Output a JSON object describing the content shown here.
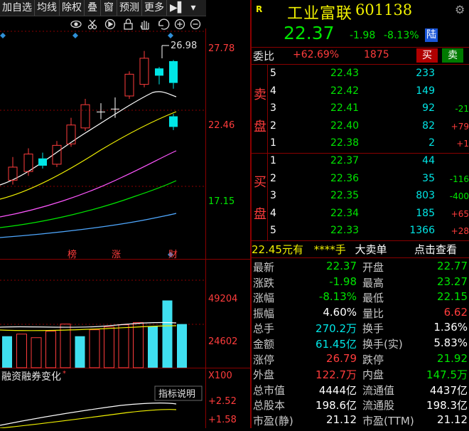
{
  "toolbar": {
    "items": [
      "加自选",
      "均线",
      "除权",
      "叠",
      "窗",
      "预测",
      "更多"
    ],
    "arrow_glyph": "▶▌",
    "dropdown_glyph": "▾"
  },
  "chart": {
    "price_ticks": [
      "27.78",
      "22.46",
      "17.15"
    ],
    "high_marker": "26.98",
    "event_markers": [
      "榜",
      "涨",
      "财"
    ],
    "volume_ticks": [
      "49204",
      "24602"
    ],
    "volume_unit": "X100",
    "indicator_title": "融资融券变化",
    "indicator_button": "指标说明",
    "indicator_ticks": [
      "+2.52",
      "+1.58"
    ],
    "candles": [
      {
        "o": 18.7,
        "c": 19.6,
        "h": 20.3,
        "l": 18.4
      },
      {
        "o": 19.3,
        "c": 20.5,
        "h": 20.9,
        "l": 19.0
      },
      {
        "o": 20.2,
        "c": 19.7,
        "h": 20.6,
        "l": 19.5
      },
      {
        "o": 19.8,
        "c": 21.1,
        "h": 21.4,
        "l": 19.6
      },
      {
        "o": 21.2,
        "c": 22.5,
        "h": 23.0,
        "l": 21.0
      },
      {
        "o": 22.3,
        "c": 23.9,
        "h": 24.3,
        "l": 22.1
      },
      {
        "o": 23.4,
        "c": 23.4,
        "h": 24.0,
        "l": 22.9
      },
      {
        "o": 23.6,
        "c": 23.6,
        "h": 24.4,
        "l": 23.0
      },
      {
        "o": 24.5,
        "c": 26.0,
        "h": 26.2,
        "l": 24.3
      },
      {
        "o": 25.3,
        "c": 27.1,
        "h": 27.6,
        "l": 25.1
      },
      {
        "o": 26.4,
        "c": 25.9,
        "h": 26.5,
        "l": 25.3
      },
      {
        "o": 26.9,
        "c": 25.4,
        "h": 26.98,
        "l": 25.0
      },
      {
        "o": 23.1,
        "c": 22.37,
        "h": 23.27,
        "l": 22.15
      }
    ],
    "volumes": [
      {
        "v": 22000,
        "up": false
      },
      {
        "v": 23500,
        "up": true
      },
      {
        "v": 21000,
        "up": true
      },
      {
        "v": 25500,
        "up": true
      },
      {
        "v": 30500,
        "up": true
      },
      {
        "v": 22000,
        "up": false
      },
      {
        "v": 26500,
        "up": true
      },
      {
        "v": 28500,
        "up": true
      },
      {
        "v": 30000,
        "up": true
      },
      {
        "v": 31500,
        "up": true
      },
      {
        "v": 29000,
        "up": false
      },
      {
        "v": 47000,
        "up": false
      },
      {
        "v": 30500,
        "up": false
      }
    ]
  },
  "header": {
    "logo": "R",
    "name": "工业富联",
    "code": "601138",
    "price": "22.37",
    "change": "-1.98",
    "change_pct": "-8.13%",
    "badge": "陆"
  },
  "weibi": {
    "label": "委比",
    "pct": "+62.69%",
    "diff": "1875",
    "buy_label": "买",
    "sell_label": "卖"
  },
  "orderbook": {
    "sell_side_label": [
      "卖",
      "盘"
    ],
    "buy_side_label": [
      "买",
      "盘"
    ],
    "sell": [
      {
        "level": "5",
        "price": "22.43",
        "volume": "233",
        "delta": ""
      },
      {
        "level": "4",
        "price": "22.42",
        "volume": "149",
        "delta": ""
      },
      {
        "level": "3",
        "price": "22.41",
        "volume": "92",
        "delta": "-21"
      },
      {
        "level": "2",
        "price": "22.40",
        "volume": "82",
        "delta": "+79"
      },
      {
        "level": "1",
        "price": "22.38",
        "volume": "2",
        "delta": "+1"
      }
    ],
    "buy": [
      {
        "level": "1",
        "price": "22.37",
        "volume": "44",
        "delta": ""
      },
      {
        "level": "2",
        "price": "22.36",
        "volume": "35",
        "delta": "-116"
      },
      {
        "level": "3",
        "price": "22.35",
        "volume": "803",
        "delta": "-400"
      },
      {
        "level": "4",
        "price": "22.34",
        "volume": "185",
        "delta": "+65"
      },
      {
        "level": "5",
        "price": "22.33",
        "volume": "1366",
        "delta": "+28"
      }
    ]
  },
  "bigorder": {
    "price": "22.45",
    "text1": "元有",
    "stars": "****",
    "unit": "手",
    "kind": "大卖单",
    "link": "点击查看"
  },
  "stats": [
    {
      "l1": "最新",
      "v1": "22.37",
      "c1": "green",
      "l2": "开盘",
      "v2": "22.77",
      "c2": "green"
    },
    {
      "l1": "涨跌",
      "v1": "-1.98",
      "c1": "green",
      "l2": "最高",
      "v2": "23.27",
      "c2": "green"
    },
    {
      "l1": "涨幅",
      "v1": "-8.13%",
      "c1": "green",
      "l2": "最低",
      "v2": "22.15",
      "c2": "green"
    },
    {
      "l1": "振幅",
      "v1": "4.60%",
      "c1": "white",
      "l2": "量比",
      "v2": "6.62",
      "c2": "red"
    },
    {
      "l1": "总手",
      "v1": "270.2万",
      "c1": "cyan",
      "l2": "换手",
      "v2": "1.36%",
      "c2": "white"
    },
    {
      "l1": "金额",
      "v1": "61.45亿",
      "c1": "cyan",
      "l2": "换手(实)",
      "v2": "5.83%",
      "c2": "white"
    },
    {
      "l1": "涨停",
      "v1": "26.79",
      "c1": "red",
      "l2": "跌停",
      "v2": "21.92",
      "c2": "green"
    },
    {
      "l1": "外盘",
      "v1": "122.7万",
      "c1": "red",
      "l2": "内盘",
      "v2": "147.5万",
      "c2": "green"
    },
    {
      "l1": "总市值",
      "v1": "4444亿",
      "c1": "white",
      "l2": "流通值",
      "v2": "4437亿",
      "c2": "white"
    },
    {
      "l1": "总股本",
      "v1": "198.6亿",
      "c1": "white",
      "l2": "流通股",
      "v2": "198.3亿",
      "c2": "white"
    },
    {
      "l1": "市盈(静)",
      "v1": "21.12",
      "c1": "white",
      "l2": "市盈(TTM)",
      "v2": "21.12",
      "c2": "white"
    }
  ]
}
